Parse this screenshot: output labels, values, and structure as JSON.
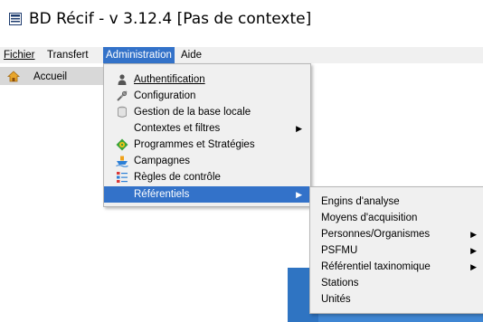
{
  "window": {
    "title": "BD Récif - v 3.12.4 [Pas de contexte]"
  },
  "menubar": {
    "items": [
      {
        "label": "Fichier",
        "mnemonic": "F"
      },
      {
        "label": "Transfert",
        "mnemonic": "T"
      },
      {
        "label": "Administration",
        "mnemonic": "d",
        "active": true
      },
      {
        "label": "Aide",
        "mnemonic": "A"
      }
    ]
  },
  "toolbar": {
    "home_label": "Accueil",
    "home_icon": "home-icon"
  },
  "admin_menu": {
    "items": [
      {
        "label": "Authentification",
        "icon": "user-icon",
        "has_submenu": false
      },
      {
        "label": "Configuration",
        "icon": "tools-icon",
        "has_submenu": false
      },
      {
        "label": "Gestion de la base locale",
        "icon": "database-icon",
        "has_submenu": false
      },
      {
        "label": "Contextes et filtres",
        "icon": "",
        "has_submenu": true
      },
      {
        "label": "Programmes et Stratégies",
        "icon": "target-icon",
        "has_submenu": false
      },
      {
        "label": "Campagnes",
        "icon": "ship-icon",
        "has_submenu": false
      },
      {
        "label": "Règles de contrôle",
        "icon": "rules-icon",
        "has_submenu": false
      },
      {
        "label": "Référentiels",
        "icon": "",
        "has_submenu": true,
        "selected": true
      }
    ]
  },
  "referentiels_menu": {
    "items": [
      {
        "label": "Engins d'analyse",
        "has_submenu": false
      },
      {
        "label": "Moyens d'acquisition",
        "has_submenu": false
      },
      {
        "label": "Personnes/Organismes",
        "has_submenu": true
      },
      {
        "label": "PSFMU",
        "has_submenu": true
      },
      {
        "label": "Référentiel taxinomique",
        "has_submenu": true
      },
      {
        "label": "Stations",
        "has_submenu": false
      },
      {
        "label": "Unités",
        "has_submenu": false
      }
    ]
  },
  "colors": {
    "selection": "#3372c9",
    "menu_bg": "#f0f0f0",
    "desktop": "#3f86d3"
  },
  "submenu_arrow": "▶"
}
